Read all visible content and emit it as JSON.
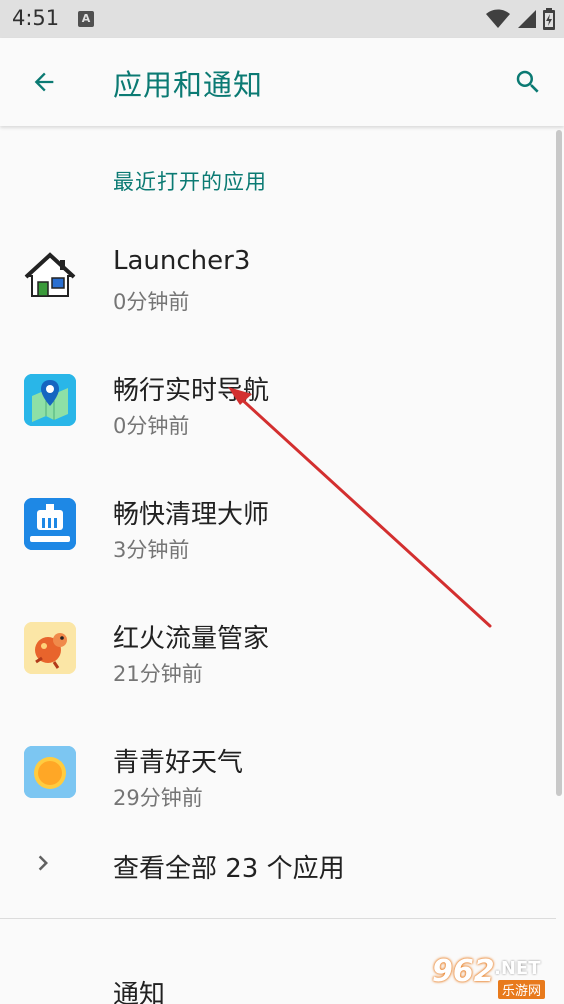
{
  "status_bar": {
    "time": "4:51",
    "badge": "A"
  },
  "app_bar": {
    "title": "应用和通知"
  },
  "recent": {
    "header": "最近打开的应用",
    "apps": [
      {
        "name": "Launcher3",
        "time": "0分钟前",
        "icon": "house-icon"
      },
      {
        "name": "畅行实时导航",
        "time": "0分钟前",
        "icon": "map-pin-icon"
      },
      {
        "name": "畅快清理大师",
        "time": "3分钟前",
        "icon": "cleaner-icon"
      },
      {
        "name": "红火流量管家",
        "time": "21分钟前",
        "icon": "fire-icon"
      },
      {
        "name": "青青好天气",
        "time": "29分钟前",
        "icon": "sun-icon"
      }
    ]
  },
  "see_all": {
    "label": "查看全部 23 个应用"
  },
  "notifications": {
    "label": "通知"
  },
  "watermark": {
    "brand": "962",
    "domain": ".NET",
    "cn": "乐游网"
  },
  "colors": {
    "accent": "#0b7a73",
    "arrow": "#d32f2f"
  }
}
